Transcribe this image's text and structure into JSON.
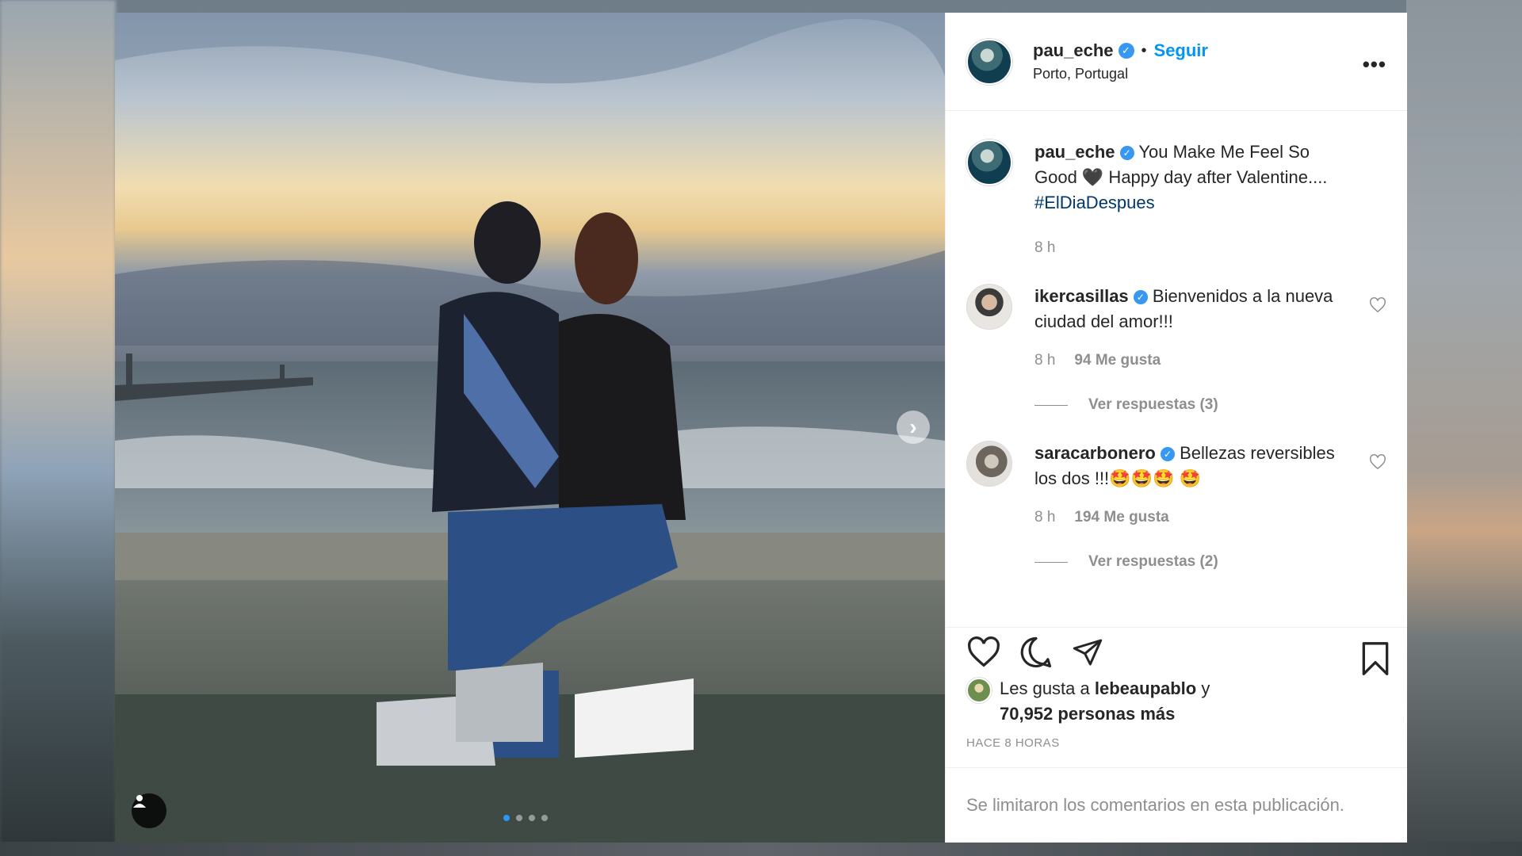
{
  "post": {
    "username": "pau_eche",
    "follow_label": "Seguir",
    "location": "Porto, Portugal",
    "more_label": "•••",
    "caption": {
      "username": "pau_eche",
      "text": "You Make Me Feel So Good 🖤 Happy day after Valentine....",
      "hashtag": "#ElDiaDespues",
      "time": "8 h"
    },
    "comments": [
      {
        "username": "ikercasillas",
        "text": "Bienvenidos a la nueva ciudad del amor!!!",
        "time": "8 h",
        "likes": "94 Me gusta",
        "replies": "Ver respuestas (3)"
      },
      {
        "username": "saracarbonero",
        "text": "Bellezas reversibles los dos !!!🤩🤩🤩 🤩",
        "time": "8 h",
        "likes": "194 Me gusta",
        "replies": "Ver respuestas (2)"
      }
    ],
    "likes": {
      "prefix": "Les gusta a",
      "user": "lebeaupablo",
      "joiner": "y",
      "others": "70,952 personas más"
    },
    "time_ago": "HACE 8 HORAS",
    "comments_limited": "Se limitaron los comentarios en esta publicación.",
    "carousel": {
      "count": 4,
      "active_index": 0
    },
    "icons": [
      "heart-icon",
      "comment-icon",
      "share-icon",
      "bookmark-icon",
      "chevron-right-icon",
      "user-tag-icon",
      "verified-badge-icon",
      "more-options-icon"
    ],
    "colors": {
      "accent": "#0095f6",
      "verified": "#3897f0",
      "text": "#262626",
      "muted": "#8e8e8e"
    }
  }
}
